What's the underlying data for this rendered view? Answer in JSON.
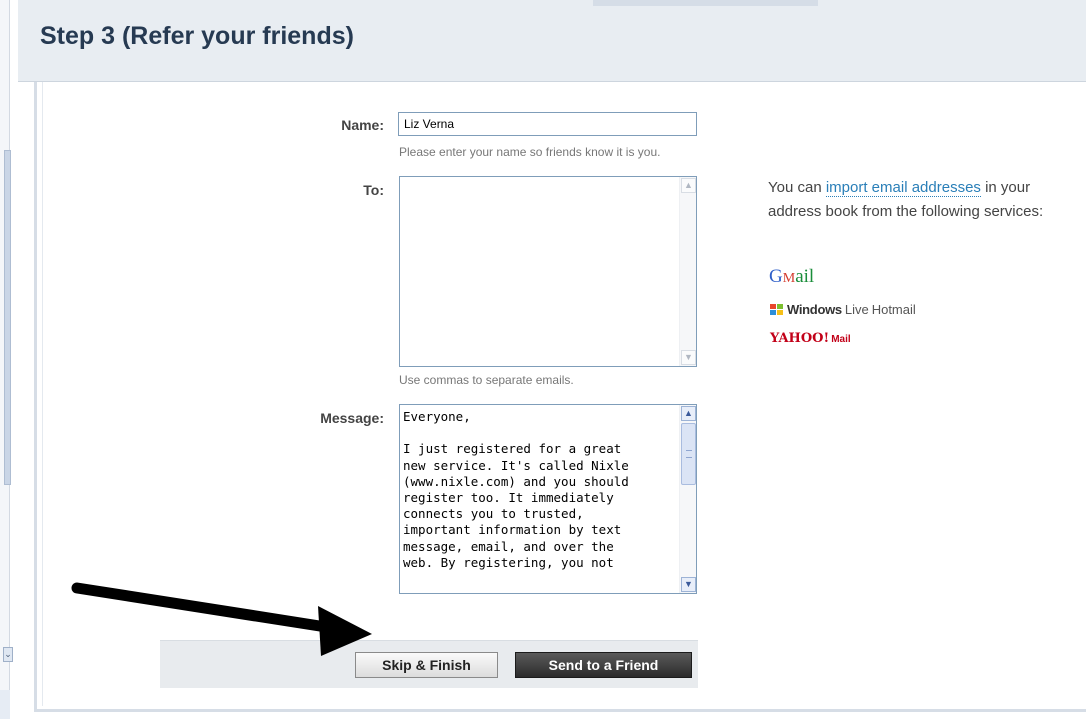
{
  "header": {
    "title": "Step 3 (Refer your friends)"
  },
  "form": {
    "name_label": "Name:",
    "name_value": "Liz Verna",
    "name_hint": "Please enter your name so friends know it is you.",
    "to_label": "To:",
    "to_value": "",
    "to_hint": "Use commas to separate emails.",
    "message_label": "Message:",
    "message_value": "Everyone,\n\nI just registered for a great\nnew service. It's called Nixle\n(www.nixle.com) and you should\nregister too. It immediately\nconnects you to trusted,\nimportant information by text\nmessage, email, and over the\nweb. By registering, you not"
  },
  "import": {
    "text_before": "You can ",
    "link_text": "import email addresses",
    "text_after": " in your address book from the following services:",
    "services": [
      "Gmail",
      "Windows Live Hotmail",
      "YAHOO! Mail"
    ]
  },
  "logos": {
    "gmail_g": "G",
    "gmail_m": "M",
    "gmail_rest": "ail",
    "hotmail_windows": "Windows",
    "hotmail_live": "Live",
    "hotmail_name": "Hotmail",
    "yahoo": "YAHOO!",
    "yahoo_mail": "Mail"
  },
  "buttons": {
    "skip_label": "Skip & Finish",
    "send_label": "Send to a Friend"
  },
  "icons": {
    "scroll_up": "scroll-up-arrow-icon",
    "scroll_down": "scroll-down-arrow-icon",
    "pointer_arrow": "pointer-arrow-icon",
    "windows_flag": "windows-flag-icon"
  },
  "colors": {
    "header_bg": "#e8edf2",
    "title": "#263a52",
    "link": "#2a7fb8",
    "send_button": "#3a3a3a",
    "yahoo": "#c20018"
  }
}
